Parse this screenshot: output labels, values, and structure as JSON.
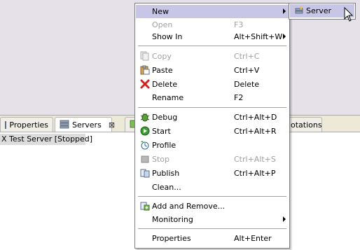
{
  "tabs": [
    {
      "label": "Properties",
      "icon": "properties-icon"
    },
    {
      "label": "Servers",
      "icon": "servers-icon",
      "close": "⊠"
    },
    {
      "label": "otations",
      "icon": "annotations-icon"
    }
  ],
  "servers_view": {
    "row": "X Test Server  [Stopped]"
  },
  "context_menu": {
    "items": [
      {
        "label": "New",
        "accel": "",
        "submenu": true,
        "highlight": true
      },
      {
        "label": "Open",
        "accel": "F3",
        "disabled": true
      },
      {
        "label": "Show In",
        "accel": "Alt+Shift+W",
        "submenu": true
      },
      {
        "label": "Copy",
        "accel": "Ctrl+C",
        "disabled": true,
        "icon": "copy-icon"
      },
      {
        "label": "Paste",
        "accel": "Ctrl+V",
        "icon": "paste-icon"
      },
      {
        "label": "Delete",
        "accel": "Delete",
        "icon": "delete-icon"
      },
      {
        "label": "Rename",
        "accel": "F2"
      },
      {
        "label": "Debug",
        "accel": "Ctrl+Alt+D",
        "icon": "debug-icon"
      },
      {
        "label": "Start",
        "accel": "Ctrl+Alt+R",
        "icon": "start-icon"
      },
      {
        "label": "Profile",
        "accel": "",
        "icon": "profile-icon"
      },
      {
        "label": "Stop",
        "accel": "Ctrl+Alt+S",
        "disabled": true,
        "icon": "stop-icon"
      },
      {
        "label": "Publish",
        "accel": "Ctrl+Alt+P",
        "icon": "publish-icon"
      },
      {
        "label": "Clean...",
        "accel": ""
      },
      {
        "label": "Add and Remove...",
        "accel": "",
        "icon": "add-remove-icon"
      },
      {
        "label": "Monitoring",
        "accel": "",
        "submenu": true
      },
      {
        "label": "Properties",
        "accel": "Alt+Enter"
      }
    ]
  },
  "submenu": {
    "items": [
      {
        "label": "Server",
        "icon": "new-server-icon",
        "highlight": true
      }
    ]
  },
  "colors": {
    "editor_bg": "#e6e0e9",
    "highlight": "#c8c6e6",
    "disabled_text": "#a0a0a0"
  }
}
